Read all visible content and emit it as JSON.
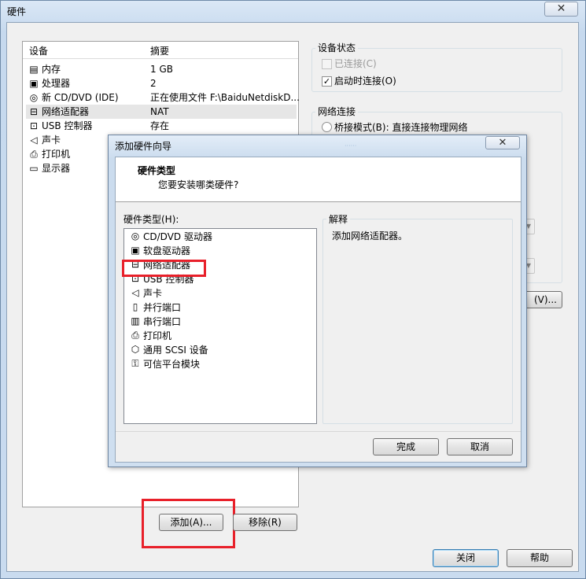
{
  "window": {
    "title": "硬件",
    "close_glyph": "✕"
  },
  "devices": {
    "columns": [
      "设备",
      "摘要"
    ],
    "rows": [
      {
        "icon": "memory-icon",
        "glyph": "▤",
        "name": "内存",
        "summary": "1 GB"
      },
      {
        "icon": "cpu-icon",
        "glyph": "▣",
        "name": "处理器",
        "summary": "2"
      },
      {
        "icon": "cd-icon",
        "glyph": "◎",
        "name": "新 CD/DVD (IDE)",
        "summary": "正在使用文件 F:\\BaiduNetdiskD..."
      },
      {
        "icon": "network-icon",
        "glyph": "⊟",
        "name": "网络适配器",
        "summary": "NAT"
      },
      {
        "icon": "usb-icon",
        "glyph": "⊡",
        "name": "USB 控制器",
        "summary": "存在"
      },
      {
        "icon": "sound-icon",
        "glyph": "◁",
        "name": "声卡",
        "summary": ""
      },
      {
        "icon": "printer-icon",
        "glyph": "⎙",
        "name": "打印机",
        "summary": ""
      },
      {
        "icon": "display-icon",
        "glyph": "▭",
        "name": "显示器",
        "summary": ""
      }
    ]
  },
  "device_status": {
    "title": "设备状态",
    "connected_label": "已连接(C)",
    "connect_at_power_on_label": "启动时连接(O)"
  },
  "network_connection": {
    "title": "网络连接",
    "bridged_label": "桥接模式(B): 直接连接物理网络"
  },
  "partial_button_label": "(V)...",
  "buttons": {
    "add": "添加(A)...",
    "remove": "移除(R)",
    "close": "关闭",
    "help": "帮助"
  },
  "wizard": {
    "title": "添加硬件向导",
    "close_glyph": "✕",
    "header_title": "硬件类型",
    "header_subtitle": "您要安装哪类硬件?",
    "list_label": "硬件类型(H):",
    "items": [
      {
        "icon": "cd-icon",
        "glyph": "◎",
        "name": "CD/DVD 驱动器"
      },
      {
        "icon": "floppy-icon",
        "glyph": "▣",
        "name": "软盘驱动器"
      },
      {
        "icon": "network-icon",
        "glyph": "⊟",
        "name": "网络适配器"
      },
      {
        "icon": "usb-icon",
        "glyph": "⊡",
        "name": "USB 控制器"
      },
      {
        "icon": "sound-icon",
        "glyph": "◁",
        "name": "声卡"
      },
      {
        "icon": "parallel-port-icon",
        "glyph": "▯",
        "name": "并行端口"
      },
      {
        "icon": "serial-port-icon",
        "glyph": "▥",
        "name": "串行端口"
      },
      {
        "icon": "printer-icon",
        "glyph": "⎙",
        "name": "打印机"
      },
      {
        "icon": "scsi-icon",
        "glyph": "⬡",
        "name": "通用 SCSI 设备"
      },
      {
        "icon": "tpm-icon",
        "glyph": "⚿",
        "name": "可信平台模块"
      }
    ],
    "explain_label": "解释",
    "explain_text": "添加网络适配器。",
    "finish": "完成",
    "cancel": "取消"
  },
  "colors": {
    "highlight": "#e8202a",
    "selected_row": "#e6e6e6"
  }
}
